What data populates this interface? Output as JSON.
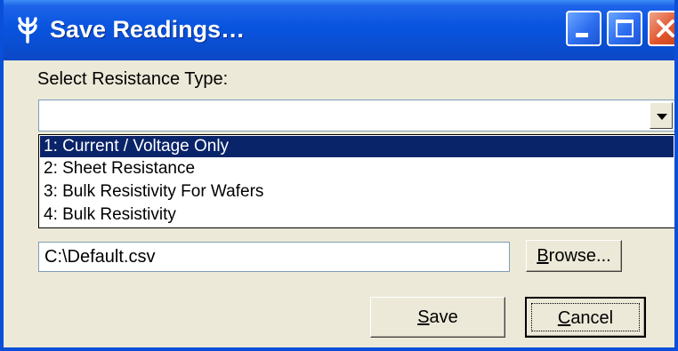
{
  "window": {
    "title": "Save Readings…",
    "icon": "app-icon",
    "controls": {
      "minimize": "minimize-icon",
      "maximize": "maximize-icon",
      "close": "close-icon"
    }
  },
  "form": {
    "resistance_label": "Select Resistance Type:",
    "combo_value": "",
    "options": [
      {
        "label": "1: Current / Voltage Only",
        "selected": true
      },
      {
        "label": "2: Sheet Resistance",
        "selected": false
      },
      {
        "label": "3: Bulk Resistivity For Wafers",
        "selected": false
      },
      {
        "label": "4: Bulk Resistivity",
        "selected": false
      }
    ],
    "file_path": "C:\\Default.csv"
  },
  "buttons": {
    "browse": {
      "mnemonic": "B",
      "rest": "rowse..."
    },
    "save": {
      "mnemonic": "S",
      "rest": "ave"
    },
    "cancel": {
      "mnemonic": "C",
      "rest": "ancel"
    }
  },
  "colors": {
    "titlebar": "#0854df",
    "dialog_bg": "#ece9d8",
    "selection": "#0a246a",
    "close_button": "#e2552d"
  }
}
